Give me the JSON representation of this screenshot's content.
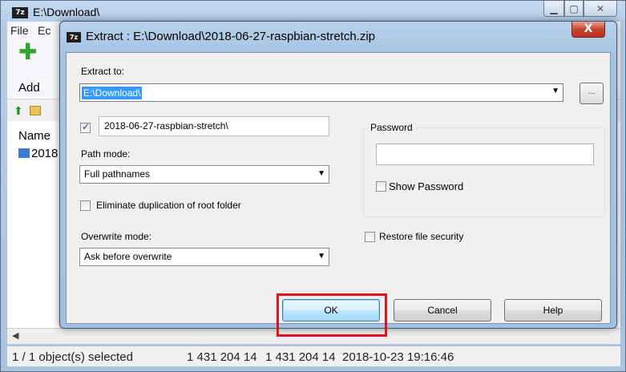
{
  "background_window": {
    "title": "E:\\Download\\",
    "title_icon": "7z",
    "menu": [
      "File",
      "Ec"
    ],
    "toolbar": {
      "add_label": "Add"
    },
    "list": {
      "column_name": "Name",
      "row_name": "2018"
    },
    "status": {
      "selected": "1 / 1 object(s) selected",
      "size": "1 431 204 14",
      "packed": "1 431 204 14",
      "modified": "2018-10-23 19:16:46"
    }
  },
  "dialog": {
    "title": "Extract : E:\\Download\\2018-06-27-raspbian-stretch.zip",
    "title_icon": "7z",
    "close_glyph": "X",
    "extract_to_label": "Extract to:",
    "extract_to_value": "E:\\Download\\",
    "browse_label": "...",
    "subfolder_checked": true,
    "subfolder_value": "2018-06-27-raspbian-stretch\\",
    "path_mode_label": "Path mode:",
    "path_mode_value": "Full pathnames",
    "eliminate_dup_label": "Eliminate duplication of root folder",
    "eliminate_dup_checked": false,
    "overwrite_mode_label": "Overwrite mode:",
    "overwrite_mode_value": "Ask before overwrite",
    "password_group_label": "Password",
    "password_value": "",
    "show_password_label": "Show Password",
    "show_password_checked": false,
    "restore_security_label": "Restore file security",
    "restore_security_checked": false,
    "ok_label": "OK",
    "cancel_label": "Cancel",
    "help_label": "Help"
  },
  "colors": {
    "selection": "#3399ff",
    "highlight_box": "#e0121a",
    "close_button": "#c5432f"
  }
}
